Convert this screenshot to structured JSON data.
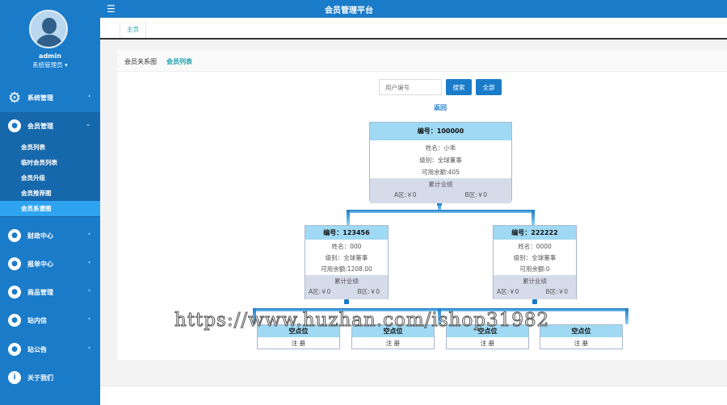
{
  "app": {
    "title": "会员管理平台"
  },
  "user": {
    "name": "admin",
    "role": "系统管理员"
  },
  "sidebar": {
    "items": [
      {
        "label": "系统管理"
      },
      {
        "label": "会员管理"
      },
      {
        "label": "财政中心"
      },
      {
        "label": "报单中心"
      },
      {
        "label": "商品管理"
      },
      {
        "label": "站内信"
      },
      {
        "label": "站公告"
      },
      {
        "label": "关于我们"
      }
    ],
    "submenu": [
      {
        "label": "会员列表"
      },
      {
        "label": "临时会员列表"
      },
      {
        "label": "会员升级"
      },
      {
        "label": "会员推荐图"
      },
      {
        "label": "会员系谱图"
      }
    ]
  },
  "tabs": {
    "home": "主页"
  },
  "panel": {
    "title": "会员关系图",
    "list_link": "会员列表"
  },
  "search": {
    "placeholder": "用户编号",
    "search_label": "搜索",
    "all_label": "全部",
    "back_label": "返回"
  },
  "tree": {
    "root": {
      "id": "编号：100000",
      "name": "姓名：小乖",
      "level": "级别：全球董事",
      "balance": "可用余额:405",
      "perf_title": "累计业绩",
      "area_a": "A区:￥0",
      "area_b": "B区:￥0"
    },
    "left": {
      "id": "编号：123456",
      "name": "姓名：000",
      "level": "级别：全球董事",
      "balance": "可用余额:1208.00",
      "perf_title": "累计业绩",
      "area_a": "A区:￥0",
      "area_b": "B区:￥0"
    },
    "right": {
      "id": "编号：222222",
      "name": "姓名：0000",
      "level": "级别：全球董事",
      "balance": "可用余额:0",
      "perf_title": "累计业绩",
      "area_a": "A区:￥0",
      "area_b": "B区:￥0"
    },
    "empty": [
      {
        "title": "空点位",
        "action": "注 册"
      },
      {
        "title": "空点位",
        "action": "注 册"
      },
      {
        "title": "空点位",
        "action": "注 册"
      },
      {
        "title": "空点位",
        "action": "注 册"
      }
    ]
  },
  "watermark": "https://www.huzhan.com/ishop31982",
  "colors": {
    "brand": "#1a7bc9",
    "active_sub": "#2ea4f0",
    "node_head": "#9fd9f3",
    "node_foot": "#d6dbea",
    "accent_text": "#1aa0ae"
  }
}
